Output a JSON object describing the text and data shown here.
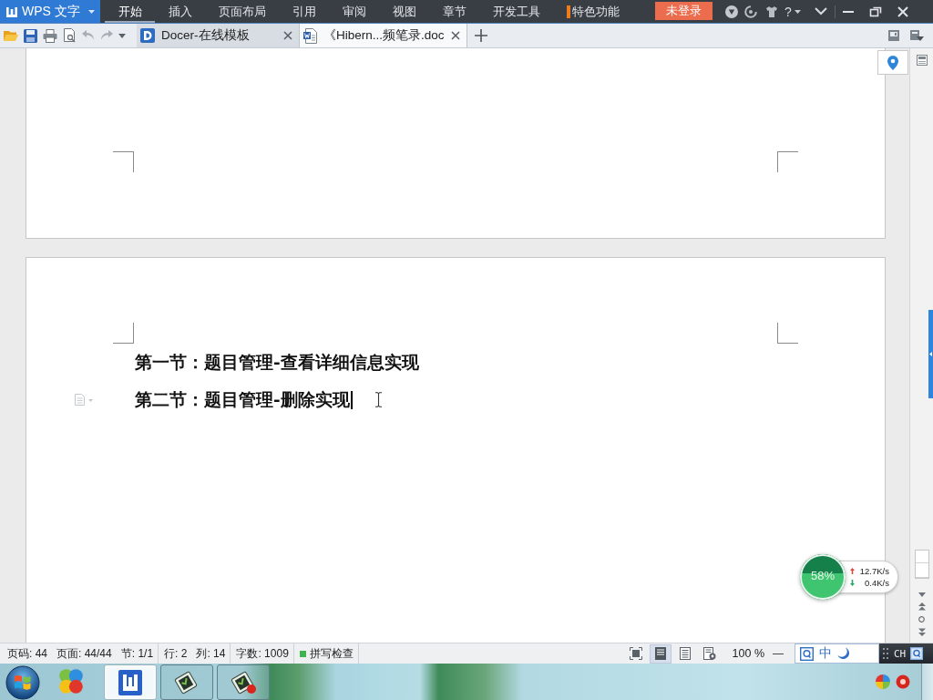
{
  "title_bar": {
    "app_button": "WPS 文字",
    "menu_tabs": [
      {
        "label": "开始",
        "selected": true,
        "kind": "plain"
      },
      {
        "label": "插入",
        "selected": false,
        "kind": "plain"
      },
      {
        "label": "页面布局",
        "selected": false,
        "kind": "plain"
      },
      {
        "label": "引用",
        "selected": false,
        "kind": "plain"
      },
      {
        "label": "审阅",
        "selected": false,
        "kind": "plain"
      },
      {
        "label": "视图",
        "selected": false,
        "kind": "plain"
      },
      {
        "label": "章节",
        "selected": false,
        "kind": "plain"
      },
      {
        "label": "开发工具",
        "selected": false,
        "kind": "plain"
      },
      {
        "label": "特色功能",
        "selected": false,
        "kind": "featured"
      }
    ],
    "login_button": "未登录",
    "help": "?"
  },
  "tab_bar": {
    "tabs": [
      {
        "label": "Docer-在线模板",
        "kind": "docer",
        "selected": false
      },
      {
        "label": "《Hibern...频笔录.doc",
        "kind": "document",
        "selected": true
      }
    ]
  },
  "document": {
    "paragraphs": [
      {
        "text": "第一节：题目管理-查看详细信息实现",
        "caret": false
      },
      {
        "text": "第二节：题目管理-删除实现",
        "caret": true
      }
    ]
  },
  "network_monitor": {
    "percent": "58%",
    "level": 0.58,
    "upload": "12.7K/s",
    "download": "0.4K/s"
  },
  "status_bar": {
    "groups": [
      [
        "页码: 44",
        "页面: 44/44",
        "节: 1/1"
      ],
      [
        "行: 2",
        "列: 14"
      ],
      [
        "字数: 1009"
      ]
    ],
    "spell_check": {
      "label": "拼写检查",
      "on": true
    },
    "view_buttons": [
      {
        "kind": "fullscreen",
        "selected": false
      },
      {
        "kind": "page",
        "selected": true
      },
      {
        "kind": "outline",
        "selected": false
      },
      {
        "kind": "web",
        "selected": false
      }
    ],
    "zoom": "100 %",
    "zoom_out": "—"
  },
  "language_bar": {
    "ime_mode": "中",
    "language": "CH"
  },
  "taskbar": {
    "apps": [
      {
        "kind": "suite",
        "open": false,
        "selected": false
      },
      {
        "kind": "writer",
        "open": true,
        "selected": true
      },
      {
        "kind": "tile",
        "open": true,
        "selected": false
      },
      {
        "kind": "tile-dot",
        "open": true,
        "selected": false
      }
    ]
  }
}
